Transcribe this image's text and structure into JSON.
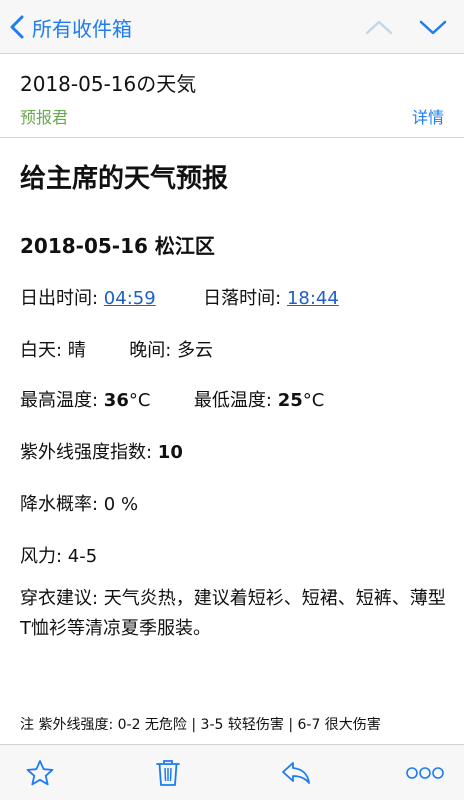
{
  "nav": {
    "back_label": "所有收件箱"
  },
  "header": {
    "subject": "2018-05-16の天気",
    "sender": "预报君",
    "details_label": "详情"
  },
  "body": {
    "title": "给主席的天气预报",
    "date_location": "2018-05-16 松江区",
    "sunrise_label": "日出时间: ",
    "sunrise_time": "04:59",
    "sunset_label": "日落时间: ",
    "sunset_time": "18:44",
    "day_label": "白天: ",
    "day_value": "晴",
    "night_label": "晚间: ",
    "night_value": "多云",
    "high_label": "最高温度: ",
    "high_value": "36",
    "low_label": "最低温度: ",
    "low_value": "25",
    "temp_unit": "°C",
    "uv_label": "紫外线强度指数: ",
    "uv_value": "10",
    "precip": "降水概率: 0 %",
    "wind": "风力: 4-5",
    "clothing": "穿衣建议: 天气炎热，建议着短衫、短裙、短裤、薄型T恤衫等清凉夏季服装。",
    "note": "注 紫外线强度: 0-2 无危险 | 3-5 较轻伤害 | 6-7 很大伤害"
  },
  "toolbar": {
    "icons": [
      "star-icon",
      "trash-icon",
      "reply-icon",
      "more-icon"
    ]
  },
  "colors": {
    "accent": "#1e7cf0",
    "sender": "#6aa84f",
    "link": "#1e5fc8"
  }
}
